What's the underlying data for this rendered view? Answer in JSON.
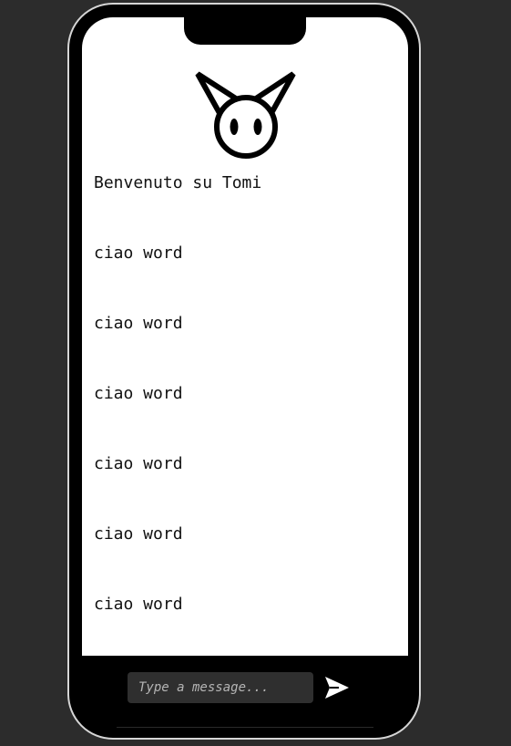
{
  "welcome_text": "Benvenuto su Tomi",
  "messages": [
    "ciao word",
    "ciao word",
    "ciao word",
    "ciao word",
    "ciao word",
    "ciao word"
  ],
  "composer": {
    "placeholder": "Type a message..."
  },
  "icons": {
    "logo": "cat-logo-icon",
    "send": "send-icon"
  },
  "colors": {
    "page_background": "#2c2c2c",
    "phone_frame": "#000000",
    "screen": "#ffffff",
    "input_background": "#2f2f2f"
  }
}
